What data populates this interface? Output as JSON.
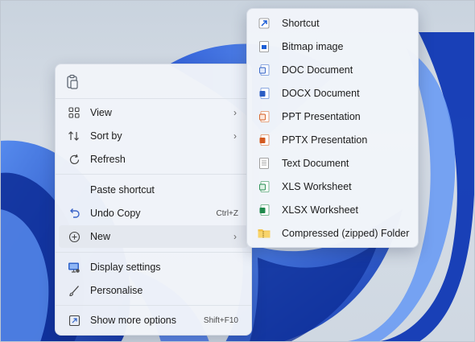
{
  "context_menu": {
    "items": [
      {
        "label": "View",
        "icon": "view-grid-icon",
        "has_submenu": true
      },
      {
        "label": "Sort by",
        "icon": "sort-icon",
        "has_submenu": true
      },
      {
        "label": "Refresh",
        "icon": "refresh-icon"
      },
      {
        "label": "Paste shortcut"
      },
      {
        "label": "Undo Copy",
        "icon": "undo-icon",
        "shortcut": "Ctrl+Z"
      },
      {
        "label": "New",
        "icon": "new-plus-icon",
        "has_submenu": true,
        "highlighted": true
      },
      {
        "label": "Display settings",
        "icon": "display-settings-icon"
      },
      {
        "label": "Personalise",
        "icon": "personalise-brush-icon"
      },
      {
        "label": "Show more options",
        "icon": "show-more-options-icon",
        "shortcut": "Shift+F10"
      }
    ]
  },
  "new_submenu": {
    "items": [
      {
        "label": "Shortcut",
        "icon": "shortcut-icon"
      },
      {
        "label": "Bitmap image",
        "icon": "bitmap-icon"
      },
      {
        "label": "DOC Document",
        "icon": "doc-icon"
      },
      {
        "label": "DOCX Document",
        "icon": "docx-icon"
      },
      {
        "label": "PPT Presentation",
        "icon": "ppt-icon"
      },
      {
        "label": "PPTX Presentation",
        "icon": "pptx-icon"
      },
      {
        "label": "Text Document",
        "icon": "text-document-icon"
      },
      {
        "label": "XLS Worksheet",
        "icon": "xls-icon"
      },
      {
        "label": "XLSX Worksheet",
        "icon": "xlsx-icon"
      },
      {
        "label": "Compressed (zipped) Folder",
        "icon": "zip-folder-icon"
      }
    ]
  },
  "colors": {
    "wallpaper_blue": "#1d4fd8",
    "menu_background": "#f1f4f9",
    "highlight": "#e4e8ef"
  }
}
